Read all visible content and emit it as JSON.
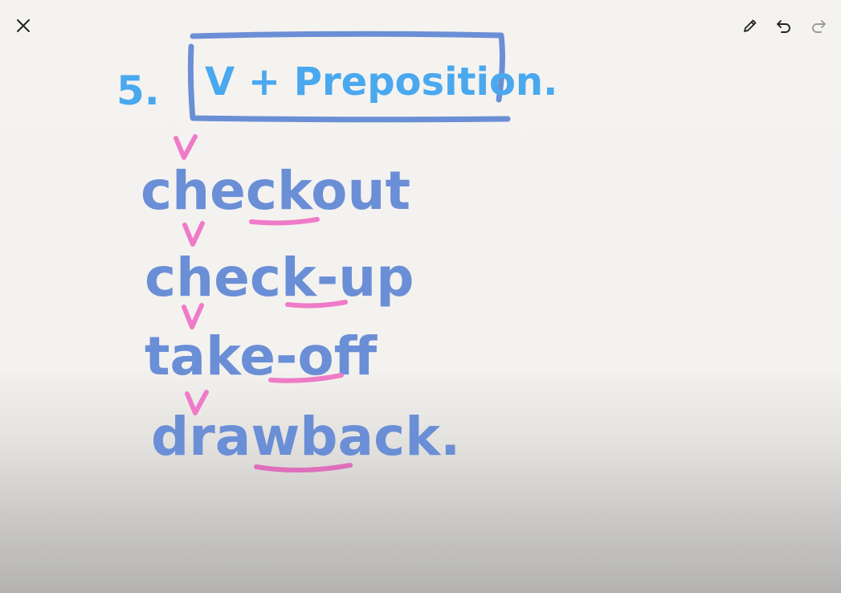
{
  "toolbar": {
    "close_icon": "close-icon",
    "pen_icon": "pen-icon",
    "undo_icon": "undo-icon",
    "redo_icon": "redo-icon"
  },
  "note": {
    "number": "5.",
    "heading": "V + Preposition.",
    "words": [
      {
        "text": "checkout",
        "check_mark": "v"
      },
      {
        "text": "check-up",
        "check_mark": "v"
      },
      {
        "text": "take-off",
        "check_mark": "v"
      },
      {
        "text": "drawback.",
        "check_mark": "v"
      }
    ]
  },
  "colors": {
    "ink_blue": "#6b8fd6",
    "ink_light_blue": "#4aa8ee",
    "ink_pink": "#ef7bc8"
  }
}
